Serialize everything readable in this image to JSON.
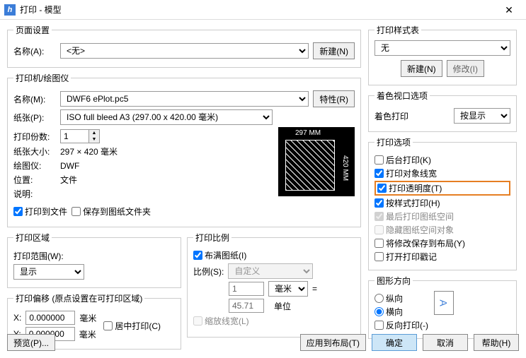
{
  "window": {
    "title": "打印 - 模型",
    "icon": "h"
  },
  "pageSetup": {
    "legend": "页面设置",
    "nameLabel": "名称(A):",
    "nameValue": "<无>",
    "newBtn": "新建(N)"
  },
  "printer": {
    "legend": "打印机/绘图仪",
    "nameLabel": "名称(M):",
    "nameValue": "DWF6 ePlot.pc5",
    "propsBtn": "特性(R)",
    "paperLabel": "纸张(P):",
    "paperValue": "ISO full bleed A3 (297.00 x 420.00 毫米)",
    "copiesLabel": "打印份数:",
    "copiesValue": "1",
    "sizeLabel": "纸张大小:",
    "sizeValue": "297 × 420  毫米",
    "plotterLabel": "绘图仪:",
    "plotterValue": "DWF",
    "locLabel": "位置:",
    "locValue": "文件",
    "descLabel": "说明:",
    "previewTop": "297 MM",
    "previewRight": "420 MM",
    "toFile": "打印到文件",
    "saveToFolder": "保存到图纸文件夹"
  },
  "area": {
    "legend": "打印区域",
    "scopeLabel": "打印范围(W):",
    "scopeValue": "显示"
  },
  "scale": {
    "legend": "打印比例",
    "fill": "布满图纸(I)",
    "scaleLabel": "比例(S):",
    "scaleValue": "自定义",
    "num": "1",
    "unit": "毫米",
    "eq": "=",
    "den": "45.71",
    "unit2": "单位",
    "scaleLW": "缩放线宽(L)"
  },
  "offset": {
    "legend": "打印偏移 (原点设置在可打印区域)",
    "xLabel": "X:",
    "xValue": "0.000000",
    "xUnit": "毫米",
    "yLabel": "Y:",
    "yValue": "0.000000",
    "yUnit": "毫米",
    "center": "居中打印(C)"
  },
  "styleTable": {
    "legend": "打印样式表",
    "value": "无",
    "newBtn": "新建(N)",
    "modBtn": "修改(I)"
  },
  "viewport": {
    "legend": "着色视口选项",
    "label": "着色打印",
    "value": "按显示"
  },
  "options": {
    "legend": "打印选项",
    "bg": "后台打印(K)",
    "lw": "打印对象线宽",
    "trans": "打印透明度(T)",
    "style": "按样式打印(H)",
    "last": "最后打印图纸空间",
    "hide": "隐藏图纸空间对象",
    "saveLayout": "将修改保存到布局(Y)",
    "openStamp": "打开打印戳记"
  },
  "orient": {
    "legend": "图形方向",
    "portrait": "纵向",
    "landscape": "横向",
    "reverse": "反向打印(-)",
    "iconText": "A"
  },
  "footer": {
    "preview": "预览(P)...",
    "applyLayout": "应用到布局(T)",
    "ok": "确定",
    "cancel": "取消",
    "help": "帮助(H)"
  }
}
